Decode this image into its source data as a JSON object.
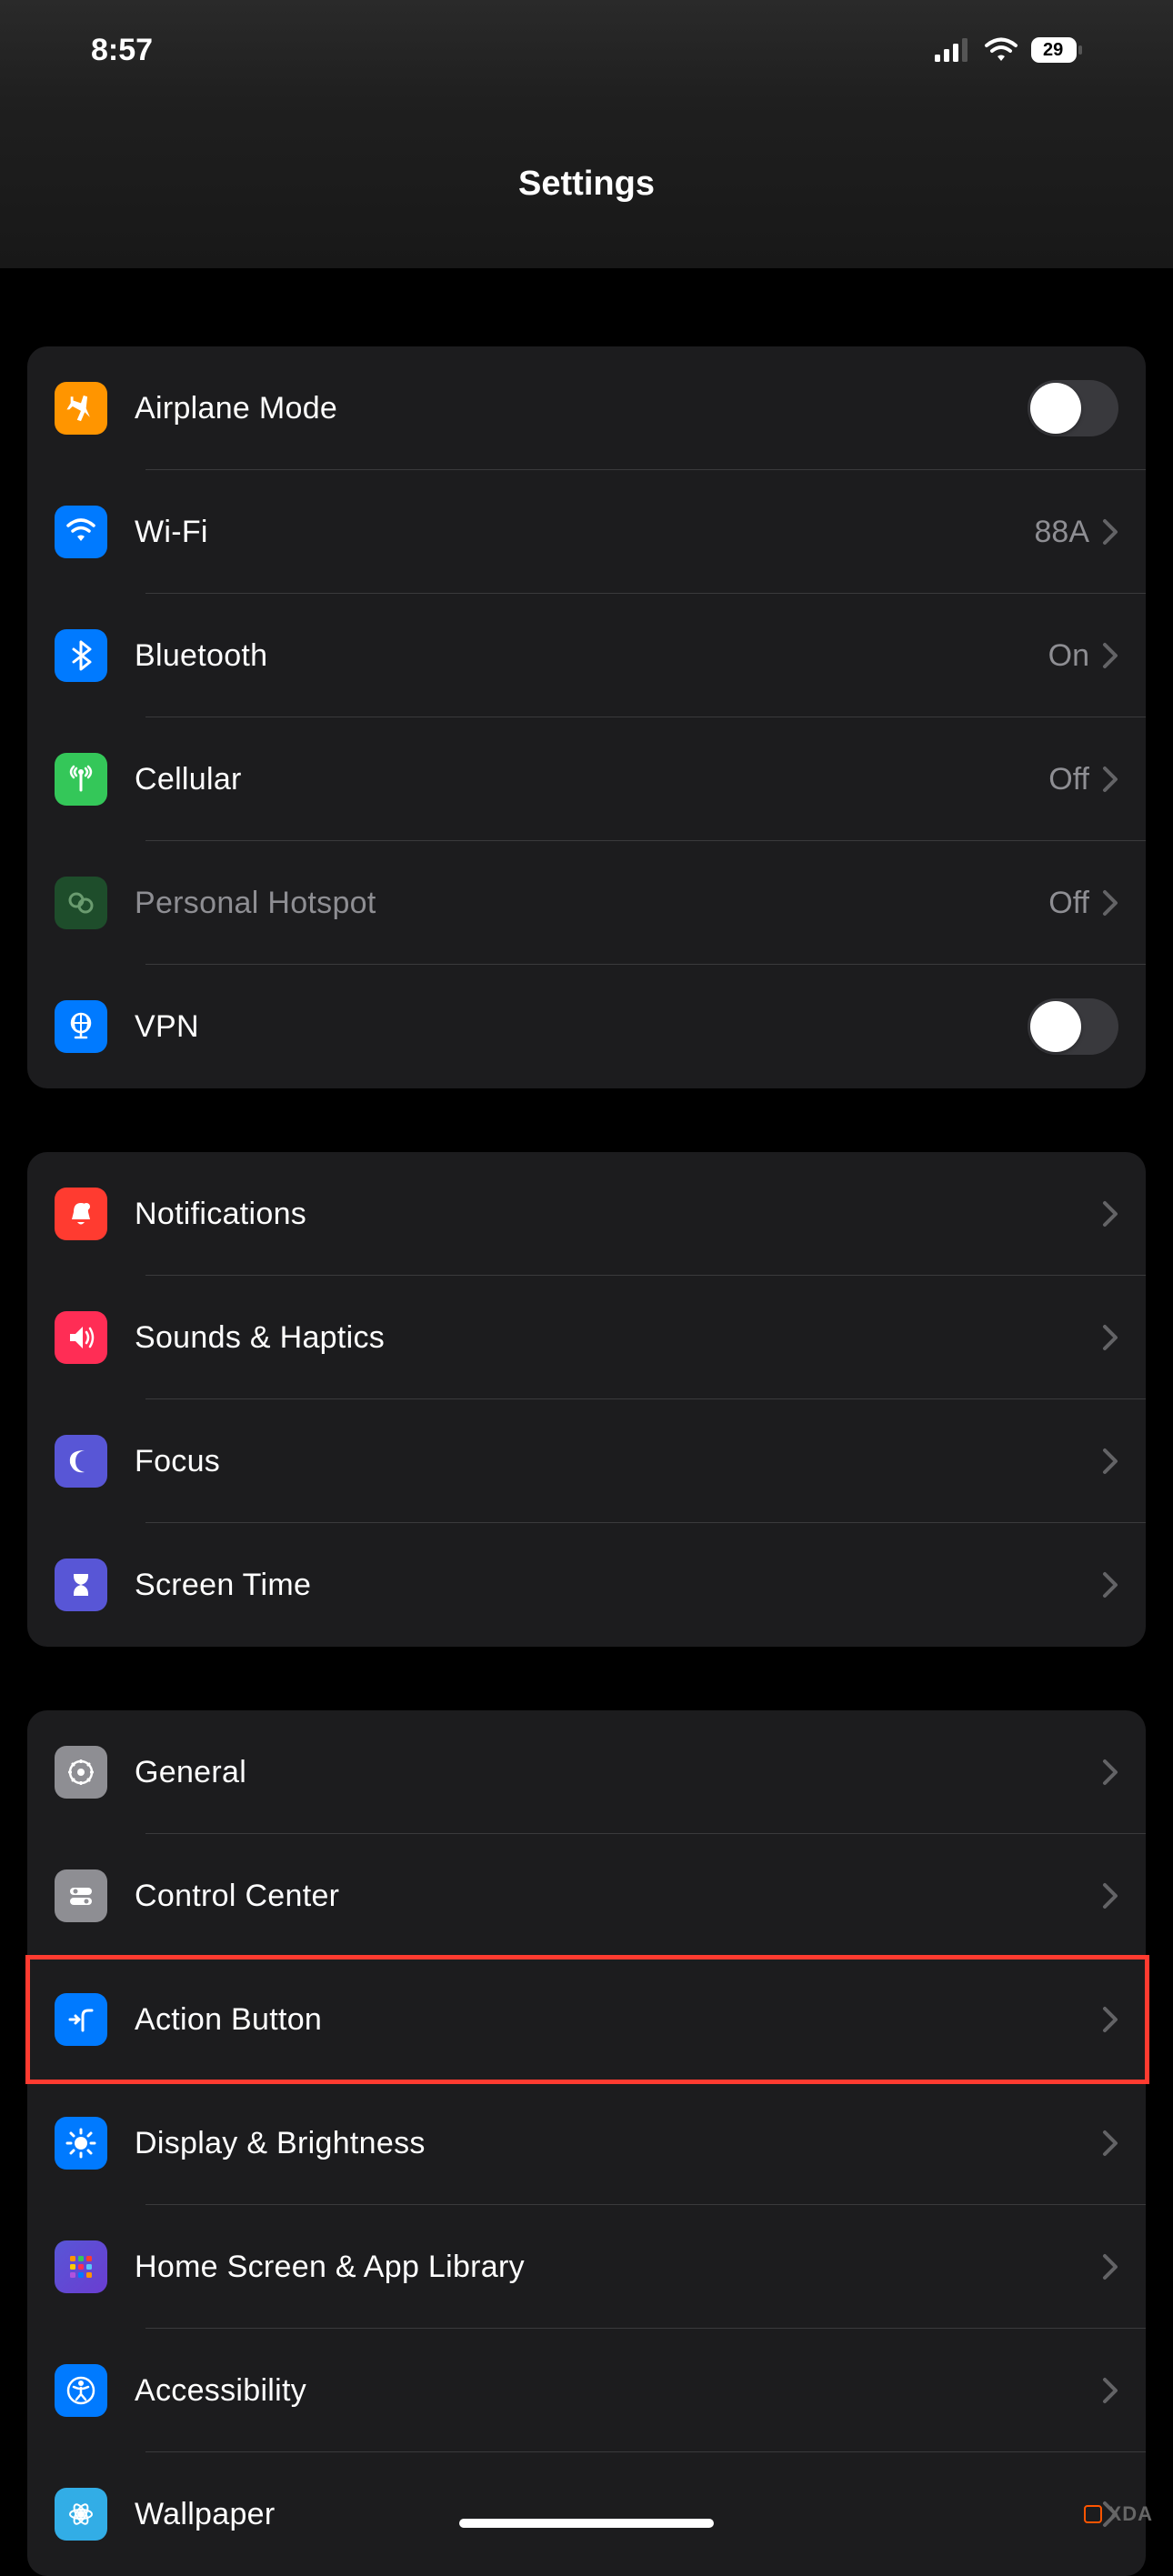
{
  "status": {
    "time": "8:57",
    "battery": "29"
  },
  "header": {
    "title": "Settings"
  },
  "g1": {
    "airplane": "Airplane Mode",
    "wifi": "Wi-Fi",
    "wifi_val": "88A",
    "bt": "Bluetooth",
    "bt_val": "On",
    "cell": "Cellular",
    "cell_val": "Off",
    "hotspot": "Personal Hotspot",
    "hotspot_val": "Off",
    "vpn": "VPN"
  },
  "g2": {
    "notif": "Notifications",
    "sounds": "Sounds & Haptics",
    "focus": "Focus",
    "screentime": "Screen Time"
  },
  "g3": {
    "general": "General",
    "cc": "Control Center",
    "action": "Action Button",
    "display": "Display & Brightness",
    "home": "Home Screen & App Library",
    "access": "Accessibility",
    "wallpaper": "Wallpaper"
  },
  "watermark": "XDA"
}
